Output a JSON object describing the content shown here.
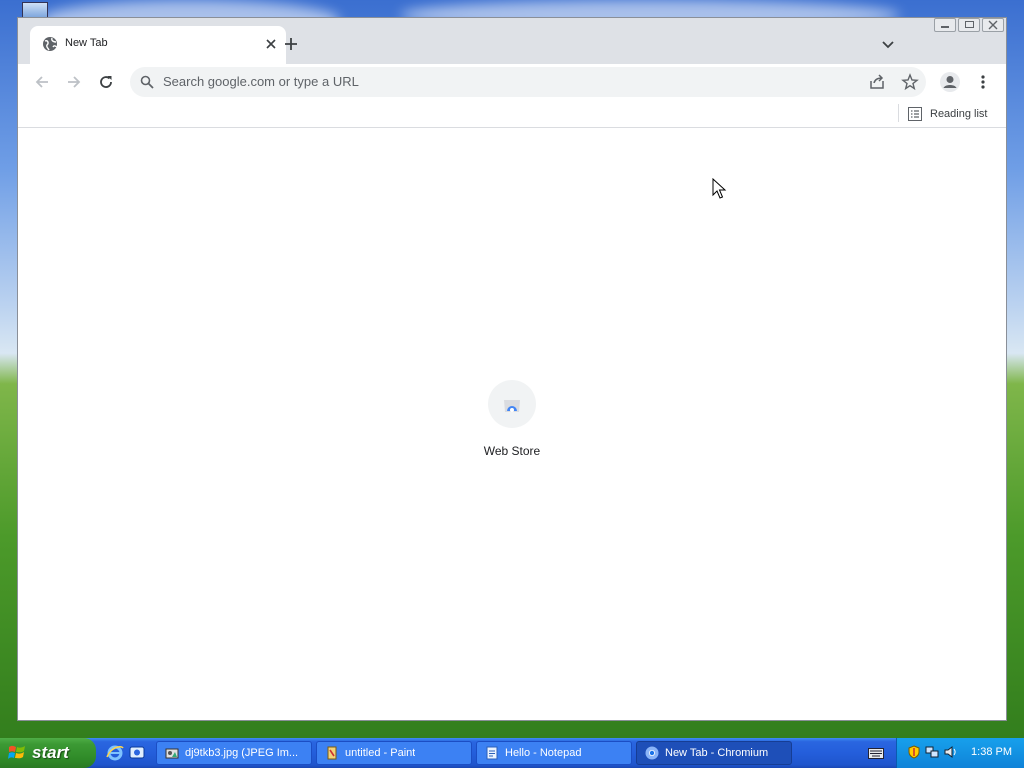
{
  "browser": {
    "tab": {
      "title": "New Tab"
    },
    "omnibox": {
      "placeholder": "Search google.com or type a URL"
    },
    "bookmarks_bar": {
      "reading_list_label": "Reading list"
    },
    "new_tab_page": {
      "shortcuts": [
        {
          "label": "Web Store"
        }
      ]
    }
  },
  "taskbar": {
    "start_label": "start",
    "tasks": [
      {
        "label": "dj9tkb3.jpg (JPEG Im...",
        "active": false
      },
      {
        "label": "untitled - Paint",
        "active": false
      },
      {
        "label": "Hello - Notepad",
        "active": false
      },
      {
        "label": "New Tab - Chromium",
        "active": true
      }
    ],
    "clock": "1:38 PM"
  },
  "colors": {
    "taskbar_blue": "#245edb",
    "start_green": "#3c9a34",
    "tray_blue": "#0f83d8",
    "chrome_frame": "#dee1e6",
    "omnibox_bg": "#f1f3f4"
  },
  "icons": {
    "tab": [
      "globe-icon",
      "close-icon"
    ],
    "tabstrip": [
      "plus-icon",
      "chevron-down-icon"
    ],
    "toolbar": [
      "back-arrow-icon",
      "forward-arrow-icon",
      "reload-icon",
      "search-icon",
      "share-icon",
      "star-icon",
      "profile-icon",
      "more-vert-icon"
    ],
    "bookmarks": [
      "reading-list-icon"
    ],
    "shortcut": [
      "web-store-icon"
    ],
    "taskbar": [
      "windows-logo-icon",
      "internet-explorer-icon",
      "show-desktop-icon",
      "image-viewer-icon",
      "paint-icon",
      "notepad-icon",
      "chromium-icon",
      "keyboard-icon",
      "shield-icon",
      "network-icon",
      "speaker-icon"
    ]
  }
}
